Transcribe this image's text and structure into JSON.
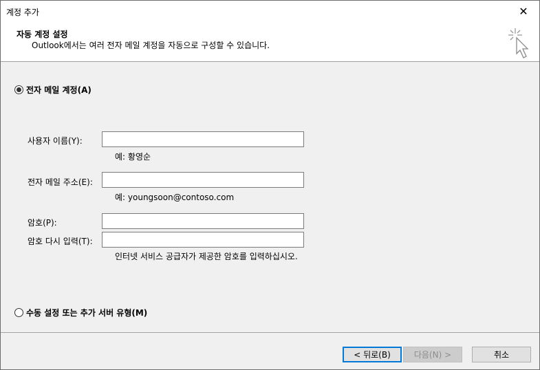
{
  "window": {
    "title": "계정 추가",
    "close_glyph": "✕"
  },
  "header": {
    "title": "자동 계정 설정",
    "subtitle": "Outlook에서는 여러 전자 메일 계정을 자동으로 구성할 수 있습니다.",
    "icon": "cursor-sparkle-icon"
  },
  "options": {
    "email_account": {
      "label": "전자 메일 계정(A)",
      "selected": true
    },
    "manual_setup": {
      "label": "수동 설정 또는 추가 서버 유형(M)",
      "selected": false
    }
  },
  "form": {
    "name": {
      "label": "사용자 이름(Y):",
      "value": "",
      "hint": "예: 황영순"
    },
    "email": {
      "label": "전자 메일 주소(E):",
      "value": "",
      "hint": "예: youngsoon@contoso.com"
    },
    "password": {
      "label": "암호(P):",
      "value": ""
    },
    "password_confirm": {
      "label": "암호 다시 입력(T):",
      "value": "",
      "hint": "인터넷 서비스 공급자가 제공한 암호를 입력하십시오."
    }
  },
  "buttons": {
    "back": "< 뒤로(B)",
    "next": "다음(N) >",
    "cancel": "취소"
  }
}
